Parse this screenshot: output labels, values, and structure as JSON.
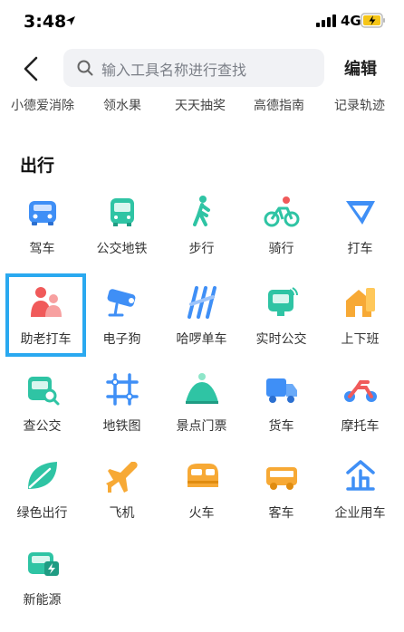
{
  "status": {
    "time": "3:48",
    "network": "4G"
  },
  "search": {
    "placeholder": "输入工具名称进行查找"
  },
  "header": {
    "edit_label": "编辑"
  },
  "shortcuts": [
    "小德爱消除",
    "领水果",
    "天天抽奖",
    "高德指南",
    "记录轨迹"
  ],
  "section": {
    "title": "出行"
  },
  "tools": [
    {
      "label": "驾车",
      "icon": "car-icon"
    },
    {
      "label": "公交地铁",
      "icon": "bus-icon"
    },
    {
      "label": "步行",
      "icon": "walk-icon"
    },
    {
      "label": "骑行",
      "icon": "bike-icon"
    },
    {
      "label": "打车",
      "icon": "taxi-icon"
    },
    {
      "label": "助老打车",
      "icon": "elder-taxi-icon",
      "selected": true
    },
    {
      "label": "电子狗",
      "icon": "camera-icon"
    },
    {
      "label": "哈啰单车",
      "icon": "hello-bike-icon"
    },
    {
      "label": "实时公交",
      "icon": "realtime-bus-icon"
    },
    {
      "label": "上下班",
      "icon": "commute-icon"
    },
    {
      "label": "查公交",
      "icon": "bus-search-icon"
    },
    {
      "label": "地铁图",
      "icon": "subway-map-icon"
    },
    {
      "label": "景点门票",
      "icon": "scenic-ticket-icon"
    },
    {
      "label": "货车",
      "icon": "truck-icon"
    },
    {
      "label": "摩托车",
      "icon": "motorcycle-icon"
    },
    {
      "label": "绿色出行",
      "icon": "leaf-icon"
    },
    {
      "label": "飞机",
      "icon": "plane-icon"
    },
    {
      "label": "火车",
      "icon": "train-icon"
    },
    {
      "label": "客车",
      "icon": "coach-icon"
    },
    {
      "label": "企业用车",
      "icon": "enterprise-car-icon"
    },
    {
      "label": "新能源",
      "icon": "new-energy-icon"
    }
  ],
  "colors": {
    "accent": "#2aa9f0",
    "blue": "#3f8ff6",
    "teal": "#2fc4a4",
    "orange": "#f7a935",
    "red": "#f05a5a"
  }
}
